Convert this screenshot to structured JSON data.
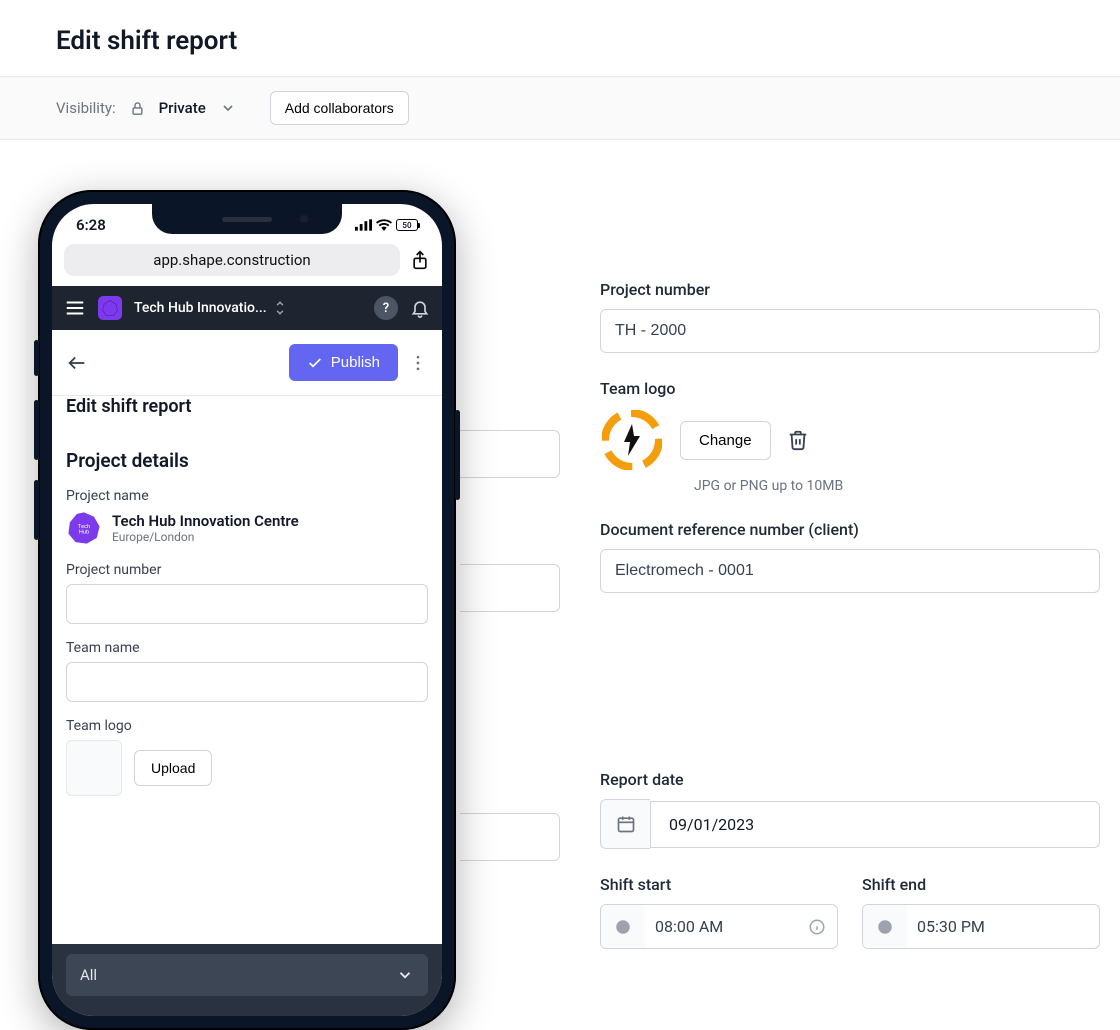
{
  "desktop": {
    "page_title": "Edit shift report",
    "visibility_label": "Visibility:",
    "visibility_value": "Private",
    "add_collaborators": "Add collaborators",
    "fields": {
      "project_number_label": "Project number",
      "project_number_value": "TH - 2000",
      "team_logo_label": "Team logo",
      "change_label": "Change",
      "logo_hint": "JPG or PNG up to 10MB",
      "doc_ref_label": "Document reference number (client)",
      "doc_ref_value": "Electromech - 0001",
      "report_date_label": "Report date",
      "report_date_value": "09/01/2023",
      "shift_start_label": "Shift start",
      "shift_start_value": "08:00 AM",
      "shift_end_label": "Shift end",
      "shift_end_value": "05:30 PM"
    }
  },
  "phone": {
    "status_time": "6:28",
    "battery_text": "50",
    "url": "app.shape.construction",
    "app_title": "Tech Hub Innovatio...",
    "publish_label": "Publish",
    "mobile_title": "Edit shift report",
    "section_title": "Project details",
    "project_name_label": "Project name",
    "project_name": "Tech Hub Innovation Centre",
    "project_tz": "Europe/London",
    "project_number_label": "Project number",
    "team_name_label": "Team name",
    "team_logo_label": "Team logo",
    "upload_label": "Upload",
    "tab_all": "All"
  }
}
